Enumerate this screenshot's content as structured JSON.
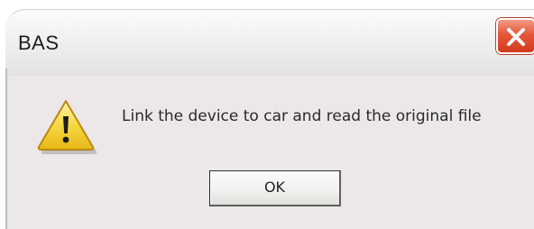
{
  "window": {
    "title": "BAS"
  },
  "dialog": {
    "message": "Link the device to car and read the original file",
    "icon": "warning-icon"
  },
  "buttons": {
    "ok_label": "OK",
    "close_icon": "close-icon"
  },
  "colors": {
    "close_button": "#d8472a",
    "body_background": "#ece7e8",
    "warning_yellow": "#f5d13b"
  }
}
